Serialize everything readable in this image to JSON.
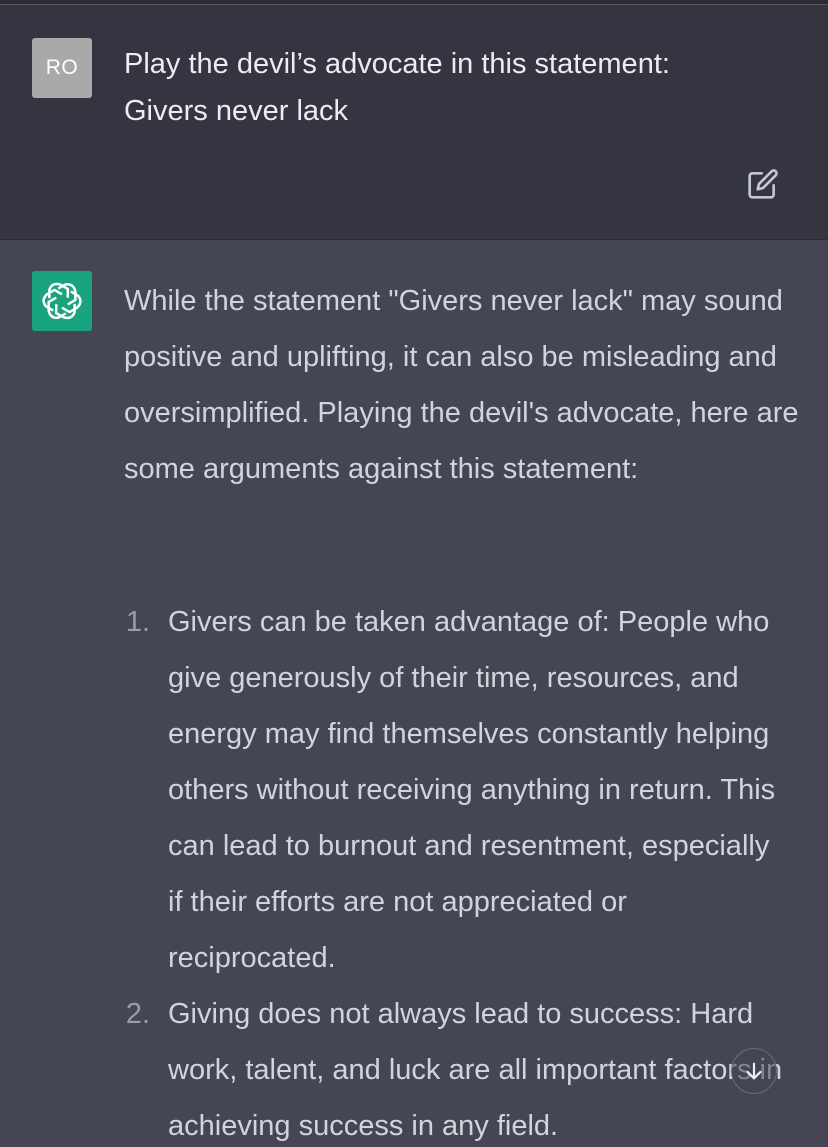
{
  "user_message": {
    "avatar_initials": "RO",
    "lines": [
      "Play the devil’s advocate in this statement:",
      "Givers never lack"
    ]
  },
  "assistant_message": {
    "intro": "While the statement \"Givers never lack\" may sound positive and uplifting, it can also be misleading and oversimplified. Playing the devil's advocate, here are some arguments against this statement:",
    "list": [
      {
        "number": "1.",
        "text": "Givers can be taken advantage of: People who give generously of their time, resources, and energy may find themselves constantly helping others without receiving anything in return. This can lead to burnout and resentment, especially if their efforts are not appreciated or reciprocated."
      },
      {
        "number": "2.",
        "text": "Giving does not always lead to success: Hard work, talent, and luck are all important factors in achieving success in any field."
      }
    ]
  },
  "icons": {
    "edit": "edit-icon",
    "assistant_logo": "openai-logo-icon",
    "scroll_down": "arrow-down-icon"
  },
  "colors": {
    "user_bg": "#343541",
    "assistant_bg": "#444654",
    "user_avatar_bg": "#a7aaa8",
    "assistant_avatar_bg": "#19a37f",
    "text": "#d1d5db"
  }
}
